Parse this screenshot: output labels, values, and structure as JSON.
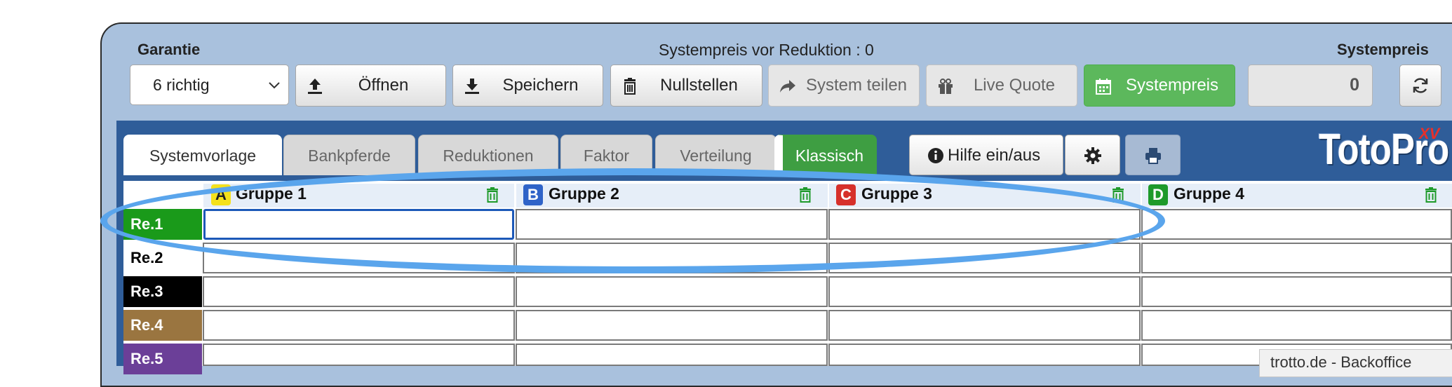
{
  "header": {
    "garantie_label": "Garantie",
    "garantie_value": "6 richtig",
    "systempreis_vor_reduktion": "Systempreis vor Reduktion : 0",
    "systempreis_label": "Systempreis",
    "systempreis_value": "0"
  },
  "toolbar": {
    "open": "Öffnen",
    "save": "Speichern",
    "reset": "Nullstellen",
    "share": "System teilen",
    "live_quote": "Live Quote",
    "systempreis": "Systempreis"
  },
  "tabs": [
    "Systemvorlage",
    "Bankpferde",
    "Reduktionen",
    "Faktor",
    "Verteilung",
    "Klassisch"
  ],
  "tools": {
    "help": "Hilfe ein/aus"
  },
  "logo": {
    "text": "TotoPro",
    "suffix": "XV"
  },
  "groups": [
    {
      "letter": "A",
      "name": "Gruppe 1",
      "color": "#f5e11a"
    },
    {
      "letter": "B",
      "name": "Gruppe 2",
      "color": "#2f63c8"
    },
    {
      "letter": "C",
      "name": "Gruppe 3",
      "color": "#d6302a"
    },
    {
      "letter": "D",
      "name": "Gruppe 4",
      "color": "#1e9a2a"
    }
  ],
  "rows": [
    {
      "label": "Re.1",
      "color": "#1a9a1a",
      "text_color": "#ffffff"
    },
    {
      "label": "Re.2",
      "color": "#ffffff",
      "text_color": "#000000"
    },
    {
      "label": "Re.3",
      "color": "#000000",
      "text_color": "#ffffff"
    },
    {
      "label": "Re.4",
      "color": "#9a7540",
      "text_color": "#ffffff"
    },
    {
      "label": "Re.5",
      "color": "#6b3f98",
      "text_color": "#ffffff"
    }
  ],
  "tooltip": "trotto.de - Backoffice"
}
